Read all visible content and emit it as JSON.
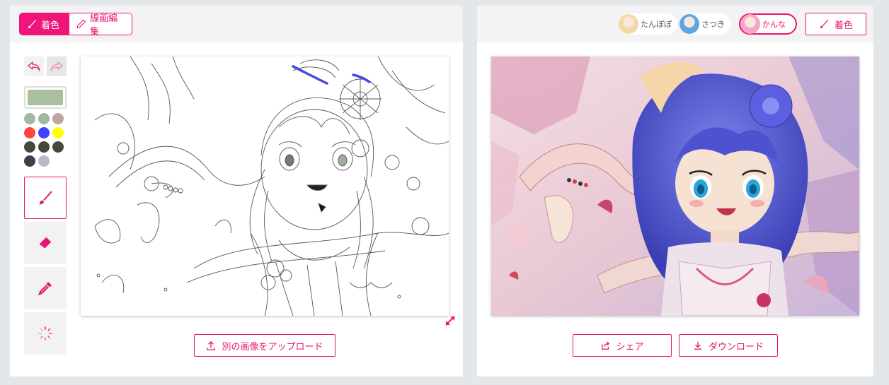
{
  "left": {
    "mode_toggle": {
      "colorize": "着色",
      "lineart": "線画編集"
    },
    "palette": {
      "current_color": "#a8c0a0",
      "swatches": [
        "#a3b8a0",
        "#a3b8a0",
        "#c1a3a3",
        "#ff4444",
        "#4040ff",
        "#ffff00",
        "#45483a",
        "#45483a",
        "#45483a",
        "#3b3f4a",
        "#b8b8c8"
      ]
    },
    "tools": [
      {
        "icon": "brush-icon",
        "active": true
      },
      {
        "icon": "eraser-icon",
        "active": false
      },
      {
        "icon": "eyedropper-icon",
        "active": false
      },
      {
        "icon": "loading-spinner-icon",
        "active": false
      }
    ],
    "upload_label": "別の画像をアップロード"
  },
  "right": {
    "models": [
      {
        "name": "たんぽぽ",
        "selected": false,
        "color": "#f3d9a4"
      },
      {
        "name": "さつき",
        "selected": false,
        "color": "#5aa7e4"
      },
      {
        "name": "かんな",
        "selected": true,
        "color": "#f4a6c8"
      }
    ],
    "colorize_label": "着色",
    "share_label": "シェア",
    "download_label": "ダウンロード"
  },
  "accent": "#e8146f"
}
